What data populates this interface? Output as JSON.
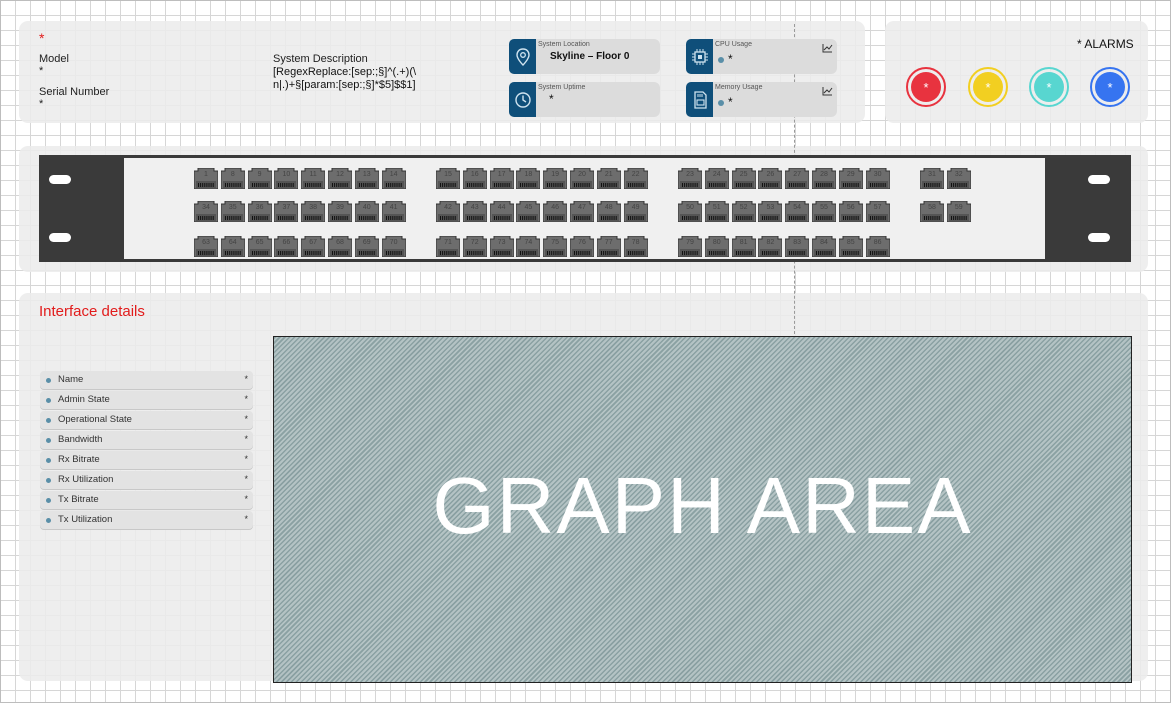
{
  "header": {
    "required_mark": "*",
    "model_label": "Model",
    "model_value": "*",
    "serial_label": "Serial Number",
    "serial_value": "*",
    "sysdesc_label": "System Description",
    "sysdesc_value_line1": "[RegexReplace:[sep:;§]^(.+)(\\",
    "sysdesc_value_line2": "n|.)+§[param:[sep:;§]*$5]$$1]"
  },
  "cards": {
    "location": {
      "title": "System Location",
      "value": "Skyline – Floor 0",
      "icon": "location-pin-icon"
    },
    "uptime": {
      "title": "System Uptime",
      "value": "*",
      "icon": "clock-icon"
    },
    "cpu": {
      "title": "CPU Usage",
      "value": "*",
      "icon": "cpu-chip-icon"
    },
    "memory": {
      "title": "Memory Usage",
      "value": "*",
      "icon": "memory-card-icon"
    }
  },
  "alarms": {
    "title": "* ALARMS",
    "items": [
      {
        "value": "*",
        "color": "#e8333f"
      },
      {
        "value": "*",
        "color": "#f2cf21"
      },
      {
        "value": "*",
        "color": "#58d6d0"
      },
      {
        "value": "*",
        "color": "#3674f0"
      }
    ]
  },
  "switch": {
    "row1": [
      "1",
      "8",
      "9",
      "10",
      "11",
      "12",
      "13",
      "14",
      "15",
      "16",
      "17",
      "18",
      "19",
      "20",
      "21",
      "22",
      "23",
      "24",
      "25",
      "26",
      "27",
      "28",
      "29",
      "30",
      "31",
      "32",
      "33"
    ],
    "row2": [
      "34",
      "35",
      "36",
      "37",
      "38",
      "39",
      "40",
      "41",
      "42",
      "43",
      "44",
      "45",
      "46",
      "47",
      "48",
      "49",
      "50",
      "51",
      "52",
      "53",
      "54",
      "55",
      "56",
      "57",
      "58",
      "59",
      "60",
      "61",
      "62"
    ],
    "row3": [
      "63",
      "64",
      "65",
      "66",
      "67",
      "68",
      "69",
      "70",
      "71",
      "72",
      "73",
      "74",
      "75",
      "76",
      "77",
      "78",
      "79",
      "80",
      "81",
      "82",
      "83",
      "84",
      "85",
      "86"
    ]
  },
  "interface": {
    "title": "Interface details",
    "rows": [
      {
        "name": "Name",
        "value": "*"
      },
      {
        "name": "Admin State",
        "value": "*"
      },
      {
        "name": "Operational State",
        "value": "*"
      },
      {
        "name": "Bandwidth",
        "value": "*"
      },
      {
        "name": "Rx Bitrate",
        "value": "*"
      },
      {
        "name": "Rx Utilization",
        "value": "*"
      },
      {
        "name": "Tx Bitrate",
        "value": "*"
      },
      {
        "name": "Tx Utilization",
        "value": "*"
      }
    ]
  },
  "graph": {
    "label": "GRAPH AREA"
  }
}
